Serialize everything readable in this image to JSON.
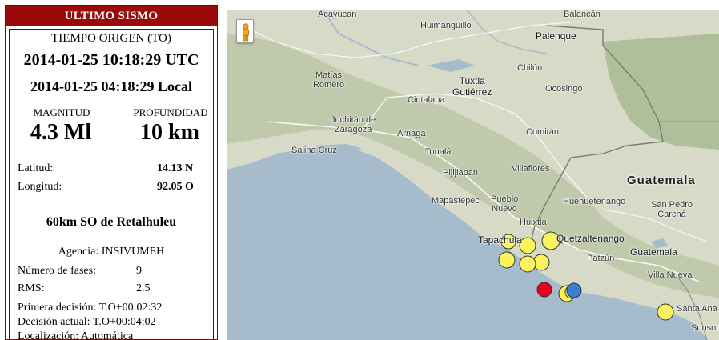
{
  "panel": {
    "title": "ULTIMO SISMO",
    "origin_label": "TIEMPO ORIGEN (TO)",
    "utc_time": "2014-01-25 10:18:29 UTC",
    "local_time": "2014-01-25 04:18:29 Local",
    "magnitude_label": "MAGNITUD",
    "depth_label": "PROFUNDIDAD",
    "magnitude": "4.3 Ml",
    "depth": "10 km",
    "lat_label": "Latitud:",
    "lat_value": "14.13 N",
    "lon_label": "Longitud:",
    "lon_value": "92.05 O",
    "place": "60km SO de Retalhuleu",
    "agency": "Agencia: INSIVUMEH",
    "phases_label": "Número de fases:",
    "phases_value": "9",
    "rms_label": "RMS:",
    "rms_value": "2.5",
    "first_decision": "Primera decisión: T.O+00:02:32",
    "current_decision": "Decisión actual: T.O+00:04:02",
    "localization": "Localización: Automática"
  },
  "map": {
    "pegman_icon": "pegman-icon",
    "labels": {
      "acayucan": "Acayucan",
      "balancan": "Balancán",
      "huimanguillo": "Huimanguillo",
      "palenque": "Palenque",
      "matias_romero": "Matías\nRomero",
      "tuxtla": "Tuxtla\nGutiérrez",
      "cintalapa": "Cintalapa",
      "chilon": "Chilón",
      "ocosingo": "Ocosingo",
      "juchitan": "Juchitán de\nZaragoza",
      "arriaga": "Arriaga",
      "comitan": "Comitán",
      "salina_cruz": "Salina Cruz",
      "tonala": "Tonalá",
      "pijijiapan": "Pijijiapan",
      "villaflores": "Villaflores",
      "guatemala_country": "Guatemala",
      "mapastepec": "Mapastepec",
      "pueblo_nuevo": "Pueblo\nNuevo",
      "huehuetenango": "Huehuetenango",
      "san_pedro_carcha": "San Pedro\nCarchá",
      "huixtla": "Huixtla",
      "tapachula": "Tapachula",
      "quetzaltenango": "Quetzaltenango",
      "patzun": "Patzún",
      "guatemala_city": "Guatemala",
      "villa_nueva": "Villa Nueva",
      "santa_ana": "Santa Ana",
      "sonsonate": "Sonsonat"
    },
    "colors": {
      "ocean": "#a6bbcc",
      "land": "#d8dac8",
      "highland": "#b9c4a5",
      "quake_latest": "#e8001e",
      "quake_recent": "#3a7fd4",
      "quake_old": "#fbf35e"
    },
    "quake_markers": [
      {
        "id": "q1",
        "kind": "old"
      },
      {
        "id": "q2",
        "kind": "old"
      },
      {
        "id": "q3",
        "kind": "old"
      },
      {
        "id": "q4",
        "kind": "old"
      },
      {
        "id": "q5",
        "kind": "old"
      },
      {
        "id": "q6",
        "kind": "old"
      },
      {
        "id": "q7",
        "kind": "old"
      },
      {
        "id": "q8",
        "kind": "latest"
      },
      {
        "id": "q9",
        "kind": "old"
      },
      {
        "id": "q10",
        "kind": "recent"
      },
      {
        "id": "q11",
        "kind": "old"
      }
    ]
  }
}
